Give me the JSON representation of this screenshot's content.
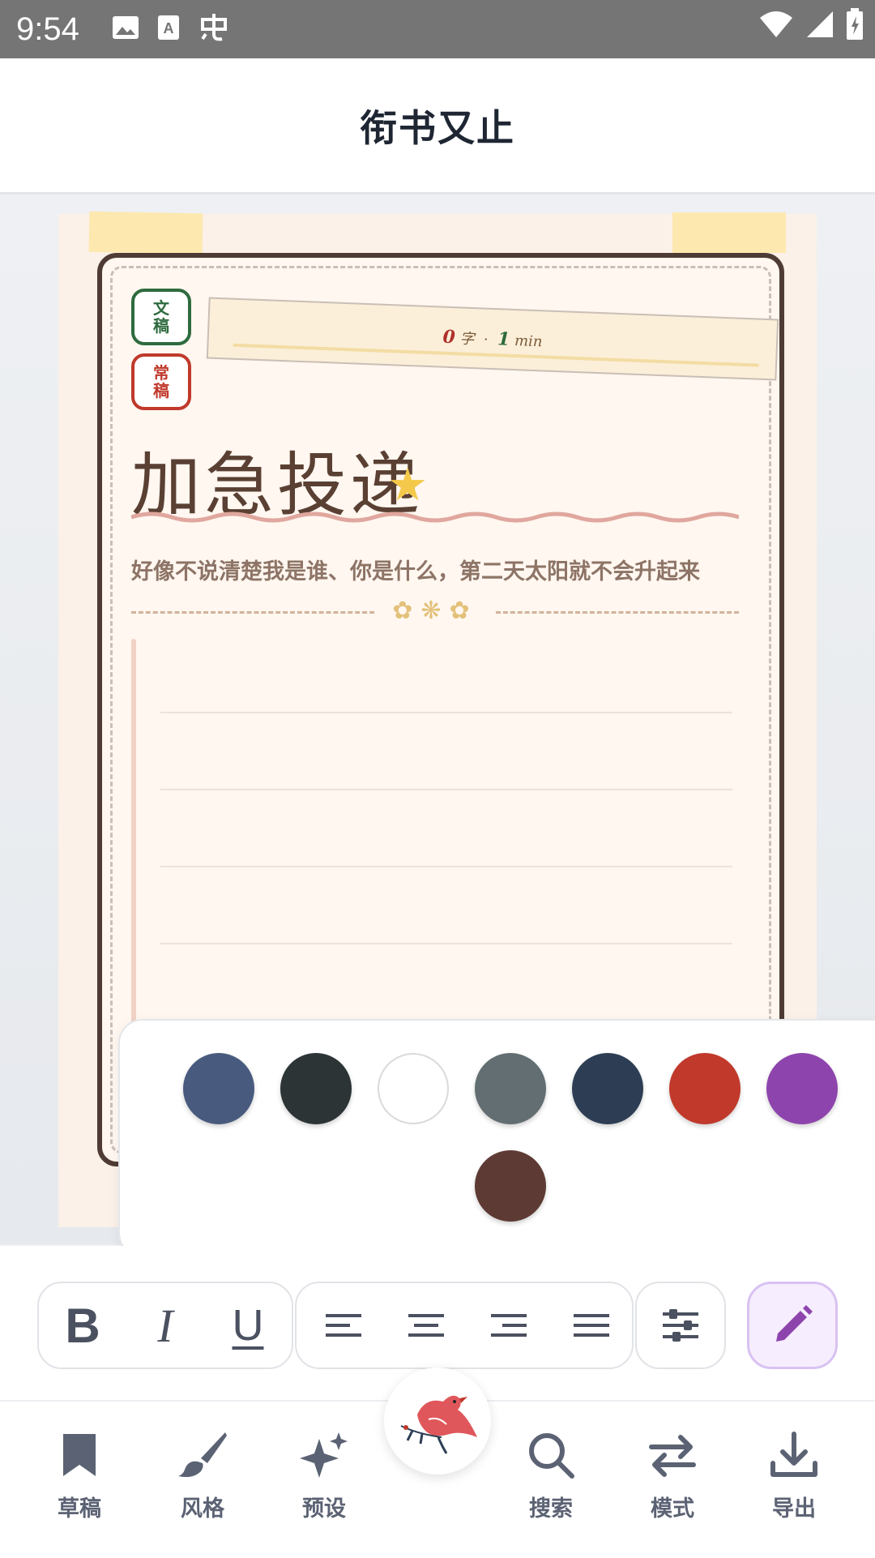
{
  "status_bar": {
    "time": "9:54",
    "icons_left": [
      "image-icon",
      "text-icon",
      "app-icon"
    ],
    "icons_right": [
      "wifi-icon",
      "signal-icon",
      "battery-icon"
    ]
  },
  "header": {
    "title": "衔书又止"
  },
  "paper": {
    "stamp_top": "文稿",
    "stamp_bottom": "常稿",
    "banner_words_num": "0",
    "banner_words_unit": "字",
    "banner_sep": "·",
    "banner_min_num": "1",
    "banner_min_unit": "min",
    "title": "加急投递",
    "subtitle": "好像不说清楚我是谁、你是什么，第二天太阳就不会升起来",
    "divider_flowers": "✿❋✿"
  },
  "color_picker": {
    "swatches": [
      "#485b7e",
      "#2d3436",
      "#ffffff",
      "#636e72",
      "#2d3e54",
      "#c0392b",
      "#8e44ad",
      "#5d3a33"
    ]
  },
  "toolbar": {
    "bold_label": "B",
    "italic_label": "I",
    "underline_label": "U",
    "pen_active_color": "#8e44ad"
  },
  "nav": {
    "items": [
      {
        "label": "草稿",
        "icon": "bookmark-icon"
      },
      {
        "label": "风格",
        "icon": "brush-icon"
      },
      {
        "label": "预设",
        "icon": "sparkle-icon"
      },
      {
        "label": "搜索",
        "icon": "search-icon"
      },
      {
        "label": "模式",
        "icon": "swap-icon"
      },
      {
        "label": "导出",
        "icon": "download-icon"
      }
    ],
    "center_icon": "bird-logo-icon"
  }
}
